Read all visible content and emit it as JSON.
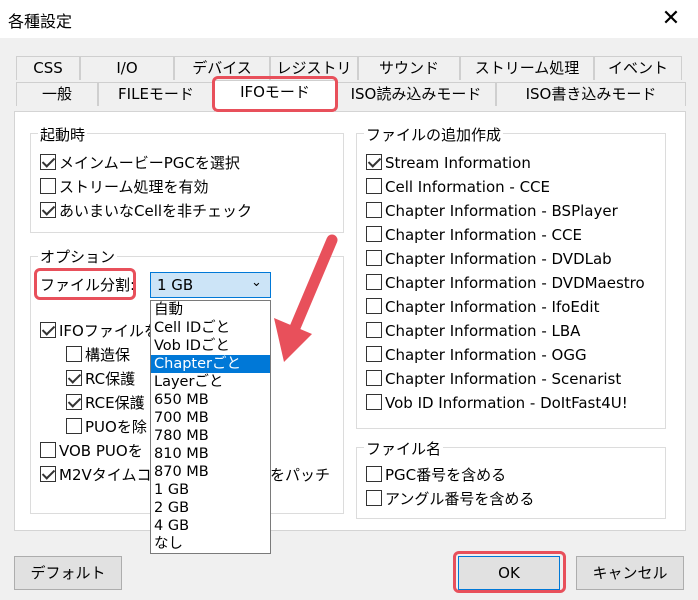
{
  "window": {
    "title": "各種設定",
    "close_symbol": "✕"
  },
  "tabs": {
    "row1": [
      "CSS",
      "I/O",
      "デバイス",
      "レジストリ",
      "サウンド",
      "ストリーム処理",
      "イベント"
    ],
    "row2": [
      "一般",
      "FILEモード",
      "IFOモード",
      "ISO読み込みモード",
      "ISO書き込みモード"
    ],
    "active": "IFOモード"
  },
  "startup": {
    "title": "起動時",
    "items": [
      {
        "label": "メインムービーPGCを選択",
        "checked": true
      },
      {
        "label": "ストリーム処理を有効",
        "checked": false
      },
      {
        "label": "あいまいなCellを非チェック",
        "checked": true
      }
    ]
  },
  "options": {
    "title": "オプション",
    "split_label": "ファイル分割:",
    "split_value": "1 GB",
    "dropdown_options": [
      "自動",
      "Cell IDごと",
      "Vob IDごと",
      "Chapterごと",
      "Layerごと",
      "650 MB",
      "700 MB",
      "780 MB",
      "810 MB",
      "870 MB",
      "1 GB",
      "2 GB",
      "4 GB",
      "なし"
    ],
    "dropdown_selected_index": 3,
    "items": [
      {
        "label": "IFOファイルを",
        "checked": true
      },
      {
        "label": "構造保",
        "checked": false
      },
      {
        "label": "RC保護",
        "checked": true
      },
      {
        "label": "RCE保護",
        "checked": true
      },
      {
        "label": "PUOを除",
        "checked": false
      },
      {
        "label": "VOB PUOを",
        "checked": false
      },
      {
        "label": "M2Vタイムコ",
        "checked": true
      }
    ],
    "m2v_suffix": "をパッチ"
  },
  "additional_files": {
    "title": "ファイルの追加作成",
    "items": [
      {
        "label": "Stream Information",
        "checked": true
      },
      {
        "label": "Cell Information - CCE",
        "checked": false
      },
      {
        "label": "Chapter Information - BSPlayer",
        "checked": false
      },
      {
        "label": "Chapter Information - CCE",
        "checked": false
      },
      {
        "label": "Chapter Information - DVDLab",
        "checked": false
      },
      {
        "label": "Chapter Information - DVDMaestro",
        "checked": false
      },
      {
        "label": "Chapter Information - IfoEdit",
        "checked": false
      },
      {
        "label": "Chapter Information - LBA",
        "checked": false
      },
      {
        "label": "Chapter Information - OGG",
        "checked": false
      },
      {
        "label": "Chapter Information - Scenarist",
        "checked": false
      },
      {
        "label": "Vob ID Information - DoItFast4U!",
        "checked": false
      }
    ]
  },
  "filename": {
    "title": "ファイル名",
    "items": [
      {
        "label": "PGC番号を含める",
        "checked": false
      },
      {
        "label": "アングル番号を含める",
        "checked": false
      }
    ]
  },
  "buttons": {
    "default": "デフォルト",
    "ok": "OK",
    "cancel": "キャンセル"
  },
  "colors": {
    "highlight": "#e8505b",
    "selection": "#0078d7",
    "combo_bg": "#cce4f7",
    "combo_border": "#0078d7"
  }
}
